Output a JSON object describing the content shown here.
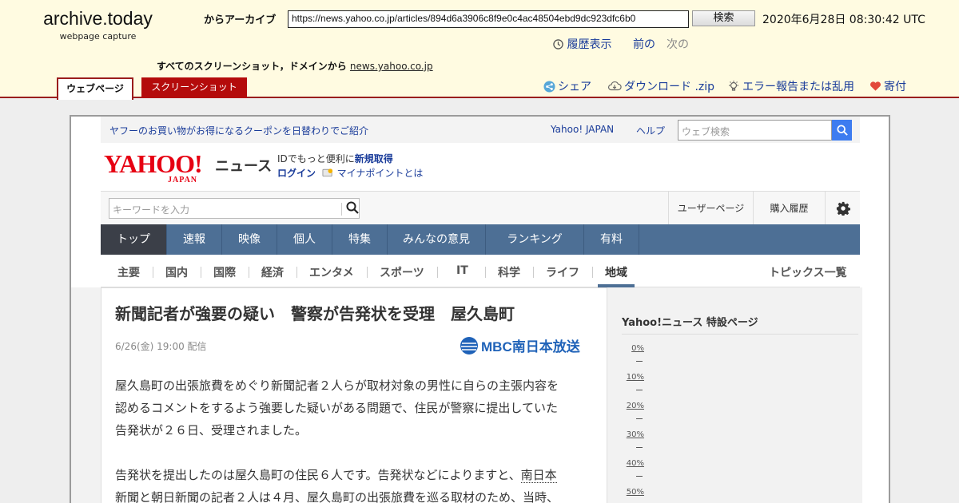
{
  "archive": {
    "logo_title": "archive.today",
    "logo_subtitle": "webpage capture",
    "archive_from_label": "からアーカイブ",
    "url_value": "https://news.yahoo.co.jp/articles/894d6a3906c8f9e0c4ac48504ebd9dc923dfc6b0",
    "search_button": "検索",
    "timestamp": "2020年6月28日 08:30:42 UTC",
    "history_label": "履歴表示",
    "prev_label": "前の",
    "next_label": "次の",
    "all_screenshots_label": "すべてのスクリーンショット，ドメインから",
    "domain_link": "news.yahoo.co.jp",
    "tab_webpage": "ウェブページ",
    "tab_screenshot": "スクリーンショット",
    "share_label": "シェア",
    "download_label": "ダウンロード .zip",
    "report_label": "エラー報告または乱用",
    "donate_label": "寄付",
    "accent_color": "#9a1d1d"
  },
  "yahoo": {
    "promo_text": "ヤフーのお買い物がお得になるクーポンを日替わりでご紹介",
    "yahoo_japan_link": "Yahoo! JAPAN",
    "help_link": "ヘルプ",
    "web_search_placeholder": "ウェブ検索",
    "logo_text": "YAHOO!",
    "logo_japan": "JAPAN",
    "news_label": "ニュース",
    "id_line_prefix": "IDでもっと便利に",
    "id_line_link": "新規取得",
    "login_link": "ログイン",
    "mynapoint_link": "マイナポイントとは",
    "keyword_placeholder": "キーワードを入力",
    "user_page": "ユーザーページ",
    "purchase_history": "購入履歴",
    "main_nav": [
      "トップ",
      "速報",
      "映像",
      "個人",
      "特集",
      "みんなの意見",
      "ランキング",
      "有料"
    ],
    "sub_nav": [
      "主要",
      "国内",
      "国際",
      "経済",
      "エンタメ",
      "スポーツ",
      "IT",
      "科学",
      "ライフ",
      "地域"
    ],
    "topics_list": "トピックス一覧",
    "brand_red": "#e60012",
    "nav_blue": "#4d6f95"
  },
  "article": {
    "title": "新聞記者が強要の疑い　警察が告発状を受理　屋久島町",
    "date": "6/26(金) 19:00 配信",
    "source": "MBC南日本放送",
    "p1_l1": "屋久島町の出張旅費をめぐり新聞記者２人らが取材対象の男性に自らの主張内容を",
    "p1_l2": "認めるコメントをするよう強要した疑いがある問題で、住民が警察に提出していた",
    "p1_l3": "告発状が２６日、受理されました。",
    "p2_l1_pre": "告発状を提出したのは屋久島町の住民６人です。告発状などによりますと、",
    "p2_l1_link": "南日本",
    "p2_l2": "新聞と朝日新聞の記者２人は４月、屋久島町の出張旅費を巡る取材のため、当時、"
  },
  "sidebar": {
    "heading": "Yahoo!ニュース 特設ページ",
    "ticks": [
      "0%",
      "10%",
      "20%",
      "30%",
      "40%",
      "50%"
    ]
  }
}
